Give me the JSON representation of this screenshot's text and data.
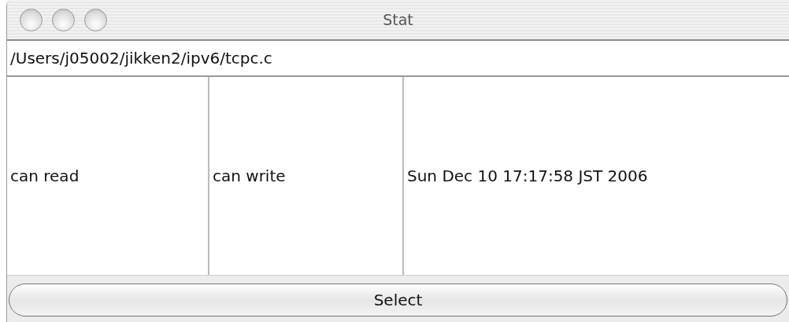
{
  "window": {
    "title": "Stat"
  },
  "path_field": {
    "value": "/Users/j05002/jikken2/ipv6/tcpc.c"
  },
  "cells": [
    "can read",
    "can write",
    "Sun Dec 10 17:17:58 JST 2006"
  ],
  "buttons": [
    "Select"
  ]
}
